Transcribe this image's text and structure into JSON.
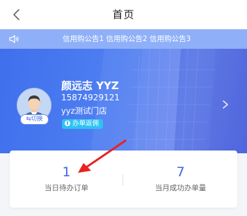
{
  "header": {
    "title": "首页"
  },
  "notice": {
    "text": "信用购公告1 信用购公告2 信用购公告3"
  },
  "user": {
    "name": "颜远志 YYZ",
    "phone": "15874929121",
    "store": "yyz测试门店",
    "switch_label": "⇆切换",
    "tag_label": "办单返佣"
  },
  "stats": [
    {
      "value": "1",
      "label": "当日待办订单"
    },
    {
      "value": "7",
      "label": "当月成功办单量"
    }
  ],
  "colors": {
    "accent": "#3f63e6",
    "notice_bg": "#8fb0f8",
    "tag_bg": "#2ec2f2",
    "annotation_arrow": "#e8231f"
  }
}
